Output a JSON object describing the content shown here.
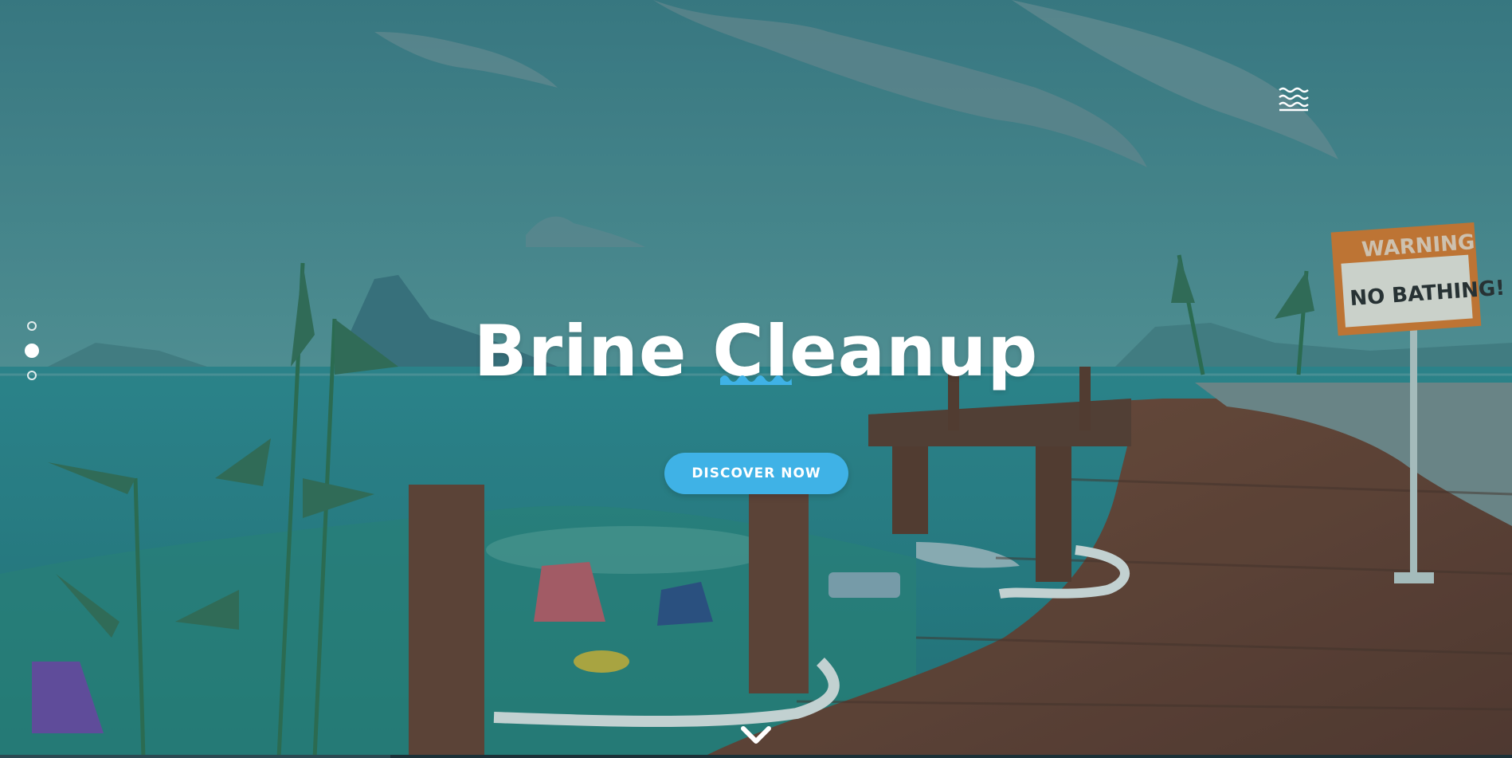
{
  "hero": {
    "title": "Brine Cleanup",
    "cta_label": "DISCOVER NOW",
    "sign_line1": "WARNING",
    "sign_line2": "NO BATHING!"
  },
  "nav": {
    "menu_icon": "wave-menu-icon",
    "slide_dots": {
      "count": 3,
      "active_index": 1
    },
    "scroll_icon": "chevron-down-icon"
  },
  "colors": {
    "accent": "#3fb2e6",
    "sky": "#4a8e94",
    "water": "#2c8f93",
    "dock": "#6a3f2e"
  }
}
